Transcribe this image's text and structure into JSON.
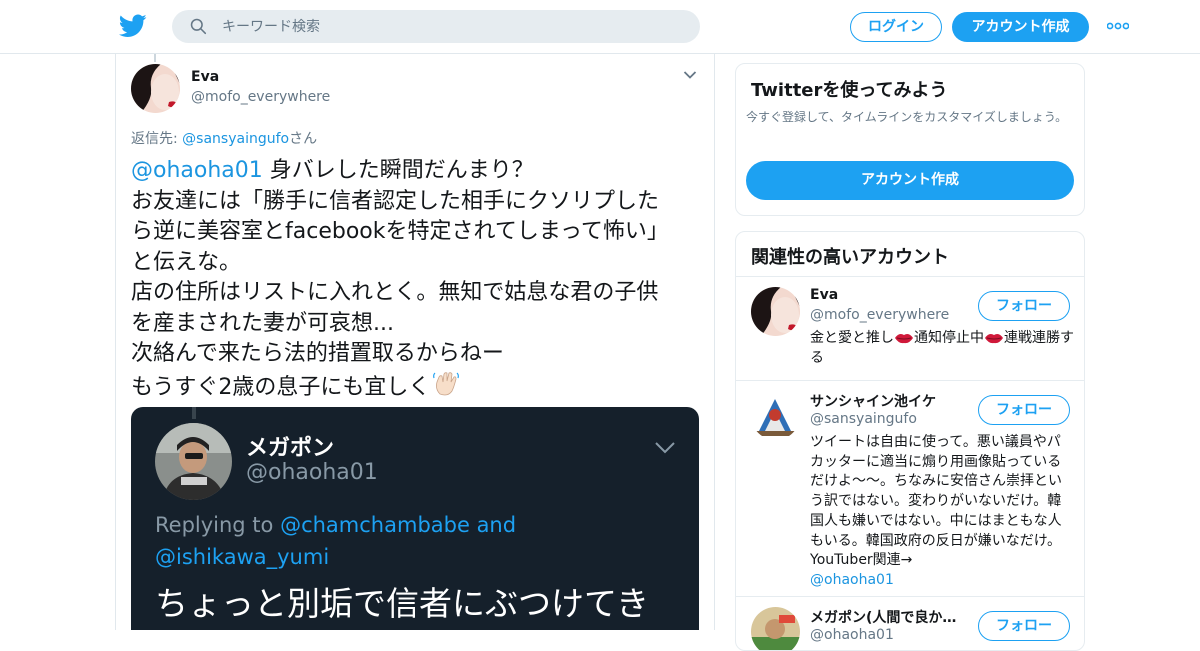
{
  "header": {
    "search_placeholder": "キーワード検索",
    "login_label": "ログイン",
    "signup_label": "アカウント作成"
  },
  "tweet": {
    "author_name": "Eva",
    "author_handle": "@mofo_everywhere",
    "reply_prefix": "返信先: ",
    "reply_mention": "@sansyaingufo",
    "reply_suffix": "さん",
    "mention": "@ohaoha01",
    "lines": [
      "  身バレした瞬間だんまり？",
      "お友達には「勝手に信者認定した相手にクソリプした",
      "ら逆に美容室とfacebookを特定されてしまって怖い」",
      "と伝えな。",
      "店の住所はリストに入れとく。無知で姑息な君の子供",
      "を産まされた妻が可哀想...",
      "次絡んで来たら法的措置取るからねー",
      "もうすぐ2歳の息子にも宜しく"
    ],
    "embedded": {
      "name": "メガポン",
      "handle": "@ohaoha01",
      "replying_prefix": "Replying to ",
      "replying_mention1": "@chamchambabe",
      "replying_and": " and",
      "replying_mention2": "@ishikawa_yumi",
      "text": "ちょっと別垢で信者にぶつけてき"
    }
  },
  "signup_card": {
    "title": "Twitterを使ってみよう",
    "description": "今すぐ登録して、タイムラインをカスタマイズしましょう。",
    "button_label": "アカウント作成"
  },
  "related": {
    "title": "関連性の高いアカウント",
    "follow_label": "フォロー",
    "accounts": [
      {
        "name": "Eva",
        "handle": "@mofo_everywhere",
        "bio_parts": [
          "金と愛と推し",
          "通知停止中",
          "連戦連勝する"
        ]
      },
      {
        "name": "サンシャイン池イケ",
        "handle": "@sansyaingufo",
        "bio": "ツイートは自由に使って。悪い議員やパカッターに適当に煽り用画像貼っているだけよ〜〜。ちなみに安倍さん崇拝という訳ではない。変わりがいないだけ。韓国人も嫌いではない。中にはまともな人もいる。韓国政府の反日が嫌いなだけ。YouTuber関連→",
        "bio_link": "@ohaoha01"
      },
      {
        "name": "メガポン(人間で良か…",
        "handle": "@ohaoha01"
      }
    ]
  },
  "colors": {
    "brand_blue": "#1da1f2",
    "link_blue": "#1b95e0",
    "embed_bg": "#15202b"
  }
}
